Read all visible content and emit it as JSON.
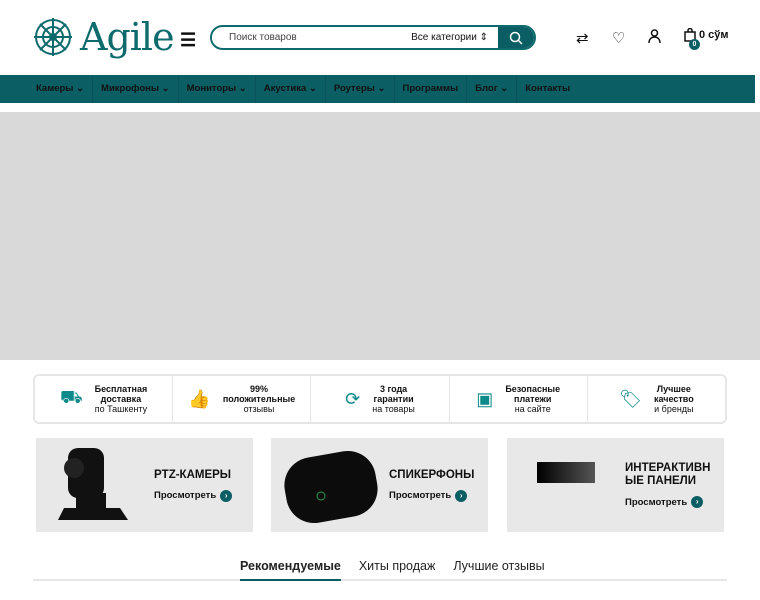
{
  "header": {
    "logo_text": "Agile",
    "search_placeholder": "Поиск товаров",
    "category": "Все категории",
    "cart_total": "0 сўм",
    "cart_count": "0"
  },
  "nav": [
    "Камеры",
    "Микрофоны",
    "Мониторы",
    "Акустика",
    "Роутеры",
    "Программы",
    "Блог",
    "Контакты"
  ],
  "nav_dropdown": [
    true,
    true,
    true,
    true,
    true,
    false,
    true,
    false
  ],
  "features": [
    {
      "icon": "truck-icon",
      "bold": [
        "Бесплатная",
        "доставка"
      ],
      "text": "по Ташкенту"
    },
    {
      "icon": "thumbs-up-icon",
      "bold": [
        "99%",
        "положительные"
      ],
      "text": "отзывы"
    },
    {
      "icon": "refresh-icon",
      "bold": [
        "3 года",
        "гарантии"
      ],
      "text": "на товары"
    },
    {
      "icon": "secure-payment-icon",
      "bold": [
        "Безопасные",
        "платежи"
      ],
      "text": "на сайте"
    },
    {
      "icon": "tag-icon",
      "bold": [
        "Лучшее",
        "качество"
      ],
      "text": "и бренды"
    }
  ],
  "cards": [
    {
      "title": "PTZ-КАМЕРЫ",
      "link": "Просмотреть"
    },
    {
      "title": "СПИКЕРФОНЫ",
      "link": "Просмотреть"
    },
    {
      "title": "ИНТЕРАКТИВН ЫЕ ПАНЕЛИ",
      "link": "Просмотреть"
    }
  ],
  "tabs": [
    "Рекомендуемые",
    "Хиты продаж",
    "Лучшие отзывы"
  ],
  "colors": {
    "brand": "#0b5e63"
  }
}
